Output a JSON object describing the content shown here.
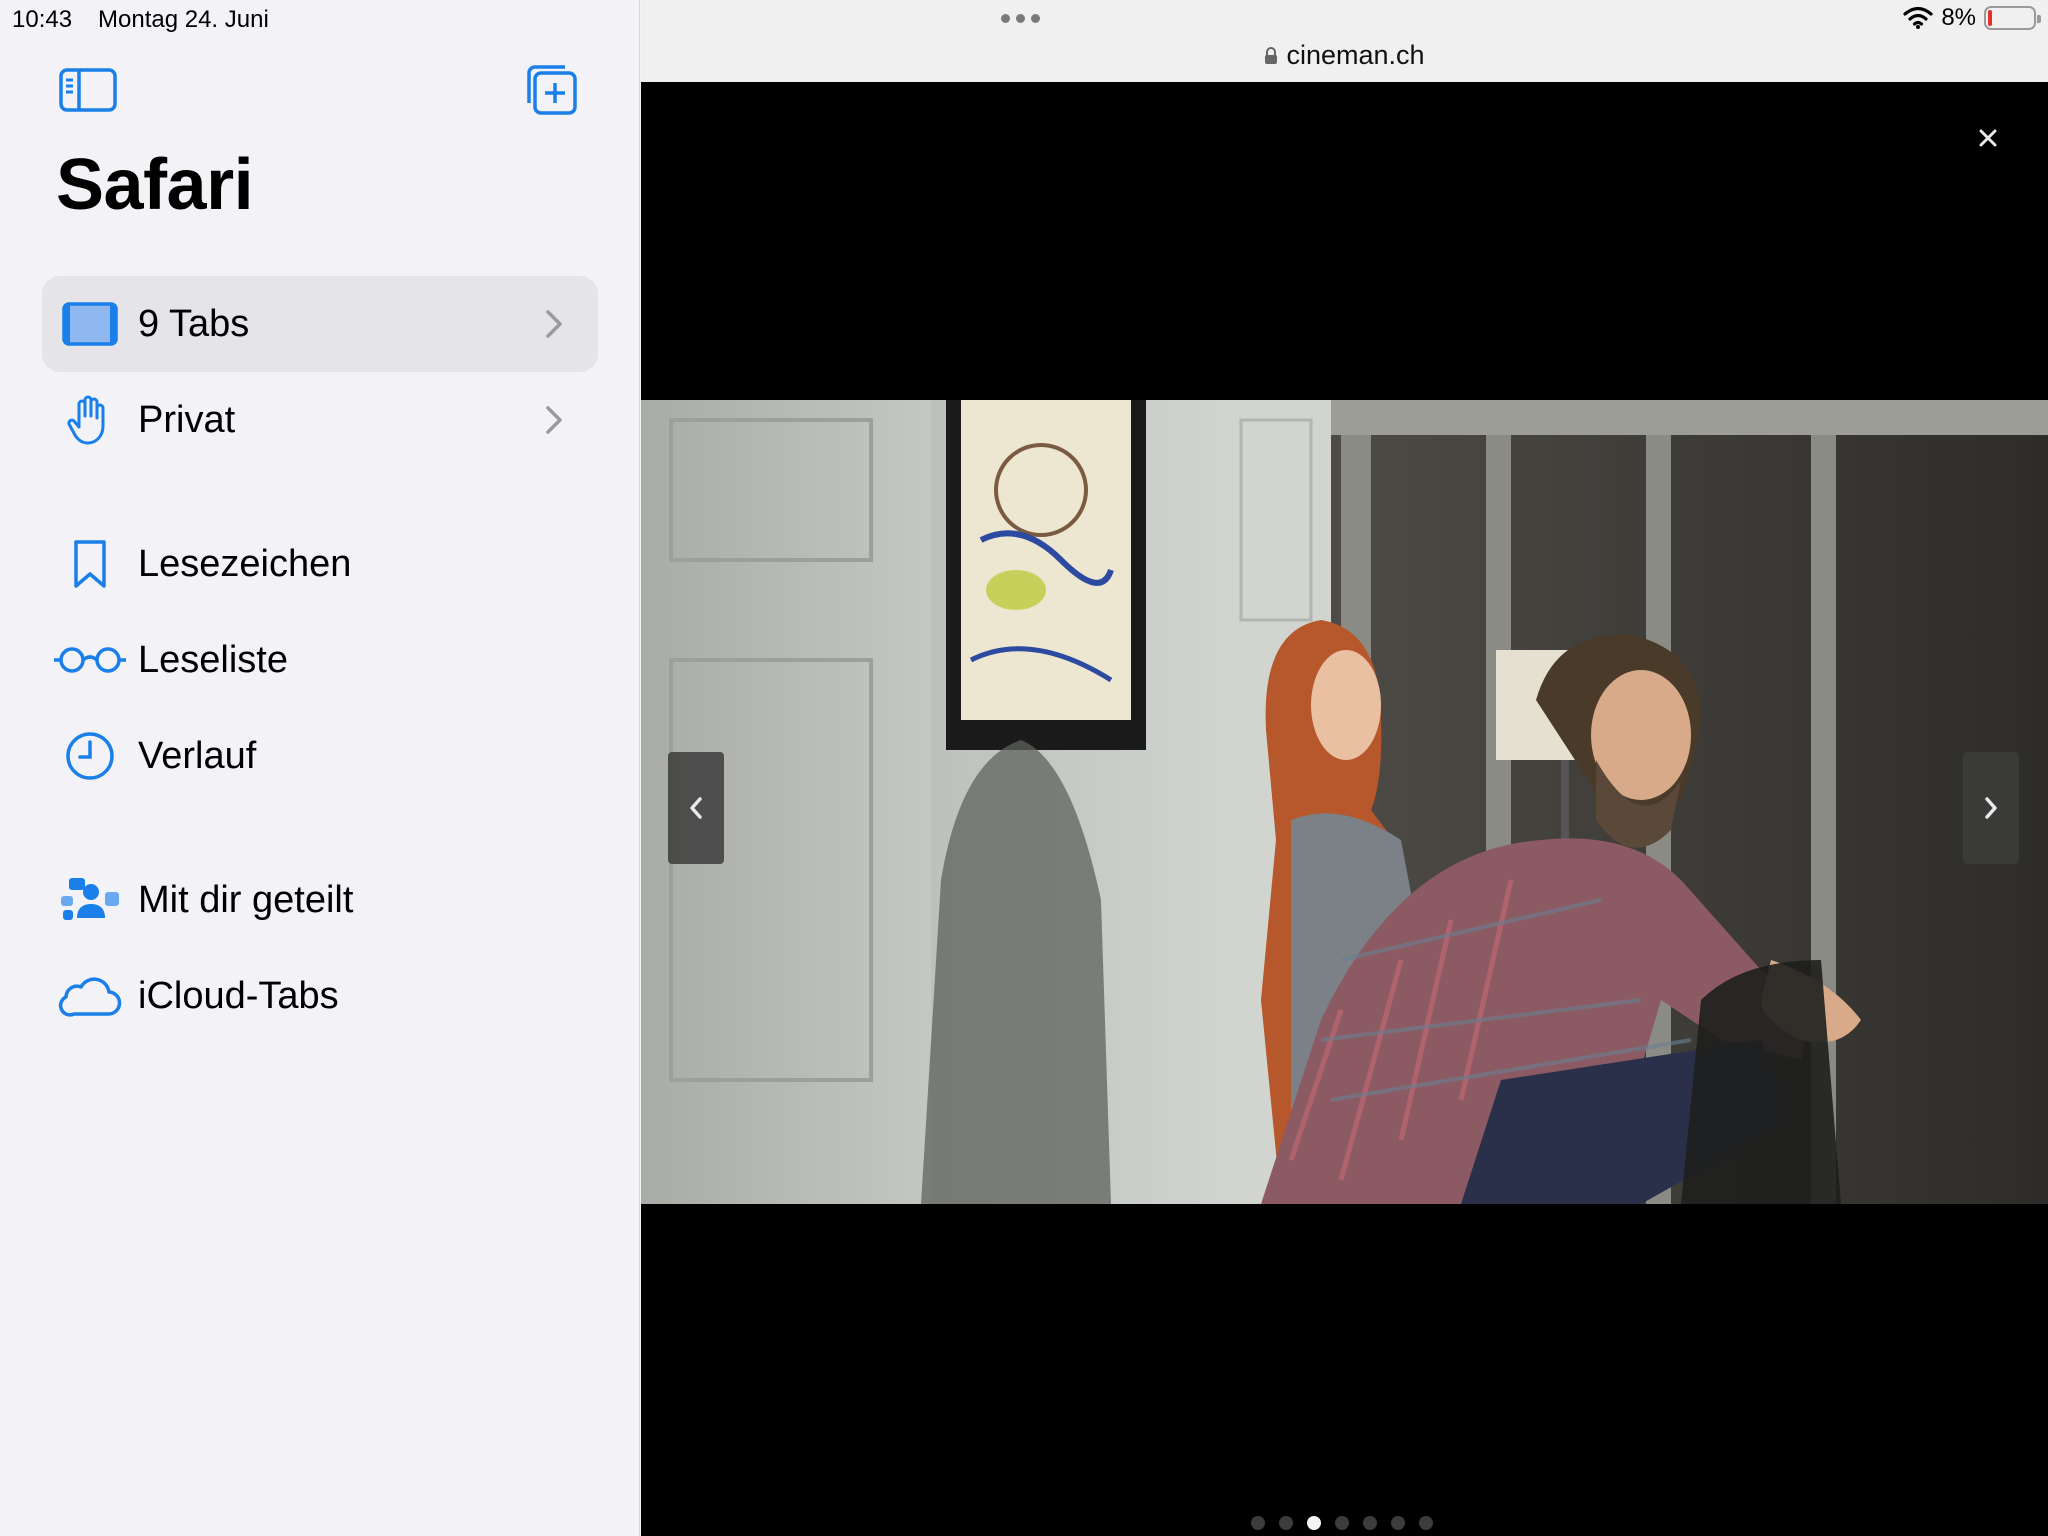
{
  "status_bar": {
    "time": "10:43",
    "date": "Montag 24. Juni",
    "battery_percent": "8%",
    "battery_level": 0.08
  },
  "sidebar": {
    "title": "Safari",
    "toggle_icon": "sidebar-icon",
    "new_tab_icon": "new-tab-group-icon",
    "items": [
      {
        "label": "9 Tabs",
        "icon": "ipad-tabs-icon",
        "selected": true,
        "has_chevron": true
      },
      {
        "label": "Privat",
        "icon": "hand-raised-icon",
        "has_chevron": true
      },
      {
        "label": "Lesezeichen",
        "icon": "bookmark-icon"
      },
      {
        "label": "Leseliste",
        "icon": "eyeglasses-icon"
      },
      {
        "label": "Verlauf",
        "icon": "clock-icon"
      },
      {
        "label": "Mit dir geteilt",
        "icon": "shared-with-you-icon"
      },
      {
        "label": "iCloud-Tabs",
        "icon": "cloud-icon"
      }
    ]
  },
  "browser": {
    "url": "cineman.ch",
    "lock_icon": "lock-icon"
  },
  "gallery": {
    "close_icon": "close-icon",
    "prev_icon": "chevron-left-icon",
    "next_icon": "chevron-right-icon",
    "page_count": 7,
    "active_page": 3
  },
  "colors": {
    "accent": "#1a7fe8",
    "sidebar_bg": "#f2f2f7",
    "selected_bg": "#e4e4e9",
    "battery_low": "#e0312b"
  }
}
